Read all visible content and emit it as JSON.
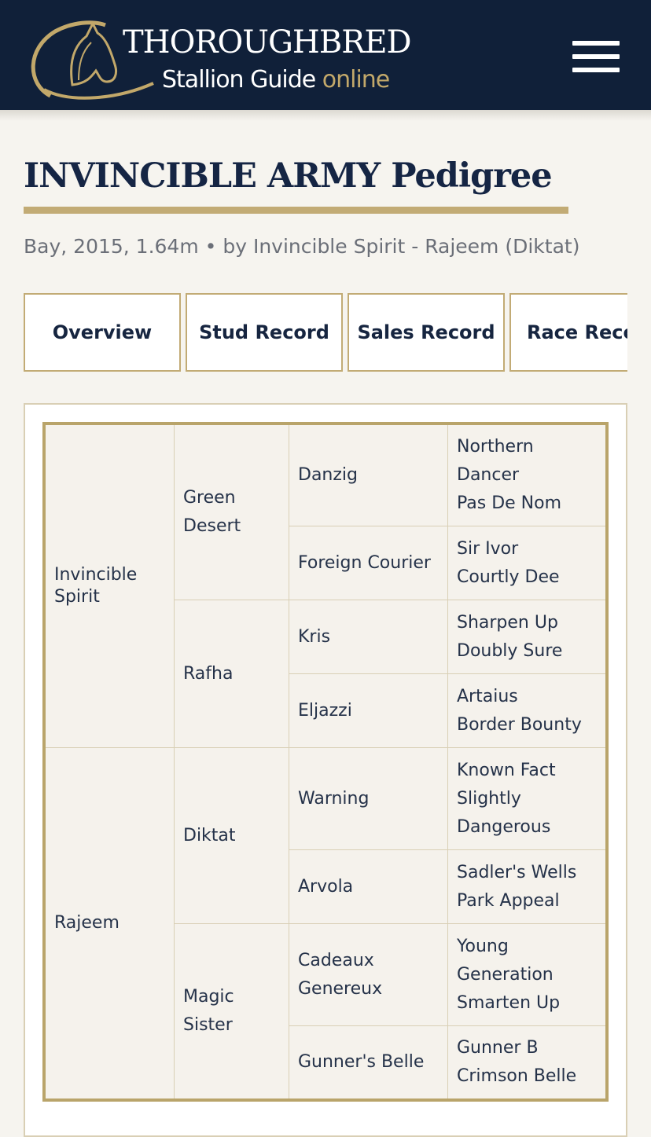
{
  "header": {
    "brand_title": "THOROUGHBRED",
    "brand_sub": "Stallion Guide",
    "brand_accent": "online",
    "menu_icon": "hamburger-menu-icon",
    "colors": {
      "navy": "#102039",
      "gold": "#c2ab75"
    }
  },
  "page": {
    "title": "INVINCIBLE ARMY Pedigree",
    "subtitle": "Bay, 2015, 1.64m • by Invincible Spirit - Rajeem (Diktat)"
  },
  "tabs": [
    {
      "label": "Overview"
    },
    {
      "label": "Stud Record"
    },
    {
      "label": "Sales Record"
    },
    {
      "label": "Race Reco"
    }
  ],
  "pedigree": {
    "sire": "Invincible\nSpirit",
    "dam": "Rajeem",
    "grandparents": [
      "Green\nDesert",
      "Rafha",
      "Diktat",
      "Magic\nSister"
    ],
    "great_grandparents": [
      "Danzig",
      "Foreign Courier",
      "Kris",
      "Eljazzi",
      "Warning",
      "Arvola",
      "Cadeaux\nGenereux",
      "Gunner's Belle"
    ],
    "fourth_gen": [
      [
        "Northern\nDancer",
        "Pas De Nom"
      ],
      [
        "Sir Ivor",
        "Courtly Dee"
      ],
      [
        "Sharpen Up",
        "Doubly Sure"
      ],
      [
        "Artaius",
        "Border Bounty"
      ],
      [
        "Known Fact",
        "Slightly\nDangerous"
      ],
      [
        "Sadler's Wells",
        "Park Appeal"
      ],
      [
        "Young\nGeneration",
        "Smarten Up"
      ],
      [
        "Gunner B",
        "Crimson Belle"
      ]
    ]
  }
}
